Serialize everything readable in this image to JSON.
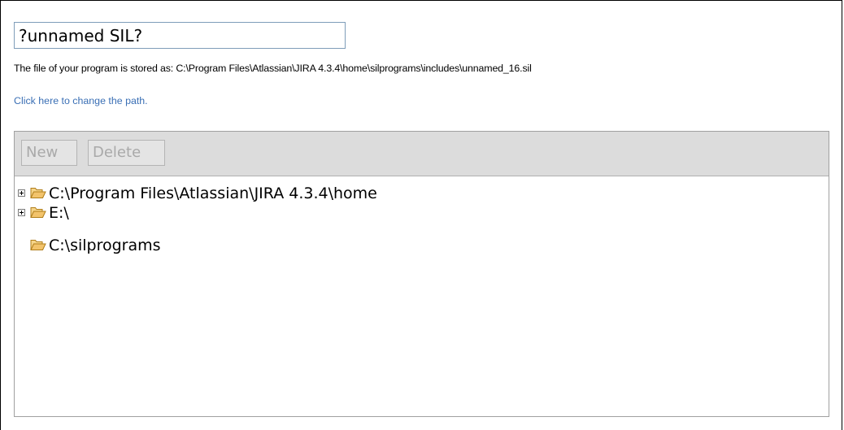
{
  "program": {
    "name_value": "?unnamed SIL?",
    "path_text": "The file of your program is stored as: C:\\Program Files\\Atlassian\\JIRA 4.3.4\\home\\silprograms\\includes\\unnamed_16.sil",
    "change_path_link": "Click here to change the path."
  },
  "toolbar": {
    "new_label": "New",
    "delete_label": "Delete"
  },
  "tree": {
    "items": [
      {
        "label": "C:\\Program Files\\Atlassian\\JIRA 4.3.4\\home",
        "expandable": true,
        "icon": "open-folder-icon"
      },
      {
        "label": "E:\\",
        "expandable": true,
        "icon": "open-folder-icon"
      },
      {
        "label": "C:\\silprograms",
        "expandable": false,
        "icon": "open-folder-icon"
      }
    ]
  },
  "colors": {
    "link": "#3a6fb5",
    "toolbar_bg": "#dcdcdc",
    "folder": "#f2c36b"
  }
}
